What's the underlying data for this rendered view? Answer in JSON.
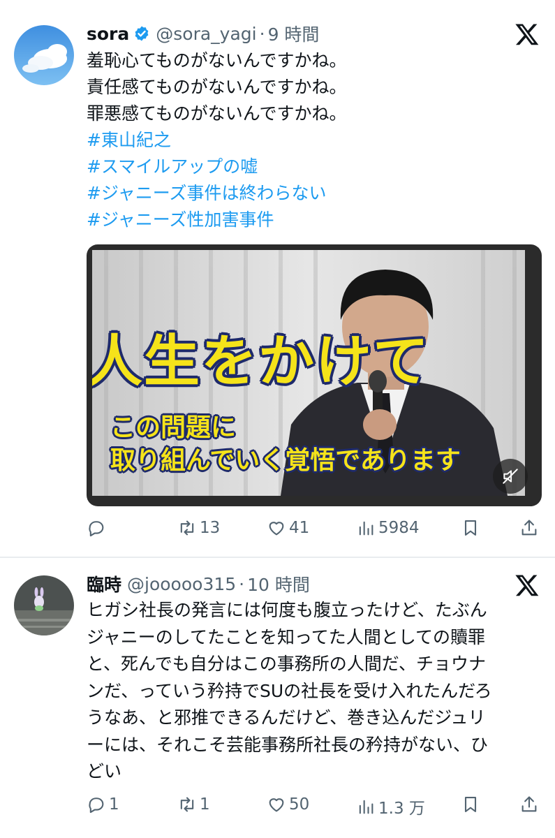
{
  "tweets": [
    {
      "name": "sora",
      "handle": "@sora_yagi",
      "dot": "·",
      "time": "9 時間",
      "lines": [
        "羞恥心てものがないんですかね。",
        "責任感てものがないんですかね。",
        "罪悪感てものがないんですかね。"
      ],
      "hashtags": [
        "#東山紀之",
        "#スマイルアップの嘘",
        "#ジャニーズ事件は終わらない",
        "#ジャニーズ性加害事件"
      ],
      "media": {
        "caption_big": "人生をかけて",
        "caption_line1": "この問題に",
        "caption_line2": "取り組んでいく覚悟であります",
        "mute_icon": "speaker-muted-icon"
      },
      "actions": {
        "reply": "",
        "retweet": "13",
        "like": "41",
        "views": "5984"
      },
      "verified": true
    },
    {
      "name": "臨時",
      "handle": "@jooooo315",
      "dot": "·",
      "time": "10 時間",
      "text_lines": [
        "ヒガシ社長の発言には何度も腹立ったけど、たぶん",
        "ジャニーのしてたことを知ってた人間としての贖罪",
        "と、死んでも自分はこの事務所の人間だ、チョウナ",
        "ンだ、っていう矜持でSUの社長を受け入れたんだろ",
        "うなあ、と邪推できるんだけど、巻き込んだジュリ",
        "ーには、それこそ芸能事務所社長の矜持がない、ひ",
        "どい"
      ],
      "actions": {
        "reply": "1",
        "retweet": "1",
        "like": "50",
        "views": "1.3 万"
      }
    }
  ],
  "colors": {
    "text": "#0f1419",
    "secondary": "#536471",
    "hashtag": "#1d9bf0",
    "verified": "#1d9bf0",
    "caption_yellow": "#f5e31a",
    "caption_outline": "#1e2a6b"
  },
  "icons": [
    "x-logo-icon",
    "verified-badge-icon",
    "reply-icon",
    "retweet-icon",
    "like-icon",
    "views-icon",
    "bookmark-icon",
    "share-icon"
  ]
}
